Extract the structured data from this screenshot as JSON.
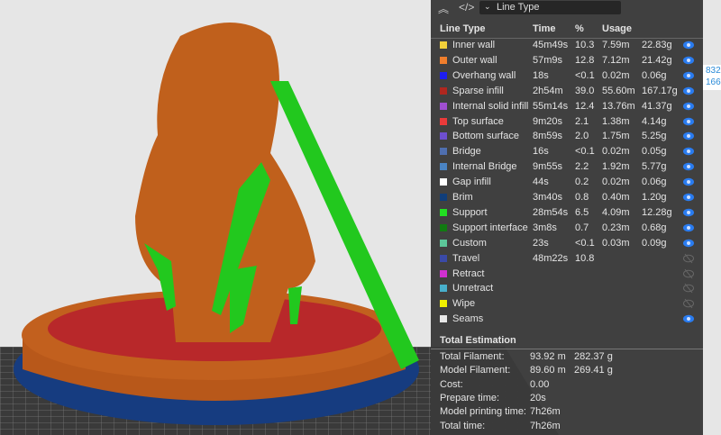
{
  "toolbar": {
    "view_select": "Line Type"
  },
  "table": {
    "headers": [
      "Line Type",
      "Time",
      "%",
      "Usage"
    ],
    "rows": [
      {
        "name": "Inner wall",
        "color": "#f2d03a",
        "time": "45m49s",
        "pct": "10.3",
        "len": "7.59m",
        "weight": "22.83g",
        "visible": true
      },
      {
        "name": "Outer wall",
        "color": "#f07e2c",
        "time": "57m9s",
        "pct": "12.8",
        "len": "7.12m",
        "weight": "21.42g",
        "visible": true
      },
      {
        "name": "Overhang wall",
        "color": "#1e1ef0",
        "time": "18s",
        "pct": "<0.1",
        "len": "0.02m",
        "weight": "0.06g",
        "visible": true
      },
      {
        "name": "Sparse infill",
        "color": "#b0271f",
        "time": "2h54m",
        "pct": "39.0",
        "len": "55.60m",
        "weight": "167.17g",
        "visible": true
      },
      {
        "name": "Internal solid infill",
        "color": "#a04fd0",
        "time": "55m14s",
        "pct": "12.4",
        "len": "13.76m",
        "weight": "41.37g",
        "visible": true
      },
      {
        "name": "Top surface",
        "color": "#ea3a3a",
        "time": "9m20s",
        "pct": "2.1",
        "len": "1.38m",
        "weight": "4.14g",
        "visible": true
      },
      {
        "name": "Bottom surface",
        "color": "#6e4fd0",
        "time": "8m59s",
        "pct": "2.0",
        "len": "1.75m",
        "weight": "5.25g",
        "visible": true
      },
      {
        "name": "Bridge",
        "color": "#4f6fb0",
        "time": "16s",
        "pct": "<0.1",
        "len": "0.02m",
        "weight": "0.05g",
        "visible": true
      },
      {
        "name": "Internal Bridge",
        "color": "#4a84c4",
        "time": "9m55s",
        "pct": "2.2",
        "len": "1.92m",
        "weight": "5.77g",
        "visible": true
      },
      {
        "name": "Gap infill",
        "color": "#ffffff",
        "time": "44s",
        "pct": "0.2",
        "len": "0.02m",
        "weight": "0.06g",
        "visible": true
      },
      {
        "name": "Brim",
        "color": "#103e7a",
        "time": "3m40s",
        "pct": "0.8",
        "len": "0.40m",
        "weight": "1.20g",
        "visible": true
      },
      {
        "name": "Support",
        "color": "#22e022",
        "time": "28m54s",
        "pct": "6.5",
        "len": "4.09m",
        "weight": "12.28g",
        "visible": true
      },
      {
        "name": "Support interface",
        "color": "#117a11",
        "time": "3m8s",
        "pct": "0.7",
        "len": "0.23m",
        "weight": "0.68g",
        "visible": true
      },
      {
        "name": "Custom",
        "color": "#5cc79a",
        "time": "23s",
        "pct": "<0.1",
        "len": "0.03m",
        "weight": "0.09g",
        "visible": true
      },
      {
        "name": "Travel",
        "color": "#3a4aa8",
        "time": "48m22s",
        "pct": "10.8",
        "len": "",
        "weight": "",
        "visible": false
      },
      {
        "name": "Retract",
        "color": "#d030d0",
        "time": "",
        "pct": "",
        "len": "",
        "weight": "",
        "visible": false
      },
      {
        "name": "Unretract",
        "color": "#48b0cc",
        "time": "",
        "pct": "",
        "len": "",
        "weight": "",
        "visible": false
      },
      {
        "name": "Wipe",
        "color": "#f0f000",
        "time": "",
        "pct": "",
        "len": "",
        "weight": "",
        "visible": false
      },
      {
        "name": "Seams",
        "color": "#e8e8e8",
        "time": "",
        "pct": "",
        "len": "",
        "weight": "",
        "visible": true
      }
    ]
  },
  "totals": {
    "title": "Total Estimation",
    "items": [
      {
        "label": "Total Filament:",
        "v1": "93.92 m",
        "v2": "282.37 g"
      },
      {
        "label": "Model Filament:",
        "v1": "89.60 m",
        "v2": "269.41 g"
      },
      {
        "label": "Cost:",
        "v1": "0.00",
        "v2": ""
      },
      {
        "label": "Prepare time:",
        "v1": "20s",
        "v2": ""
      },
      {
        "label": "Model printing time:",
        "v1": "7h26m",
        "v2": ""
      },
      {
        "label": "Total time:",
        "v1": "7h26m",
        "v2": ""
      }
    ]
  },
  "coord": {
    "a": "832",
    "b": "166."
  }
}
